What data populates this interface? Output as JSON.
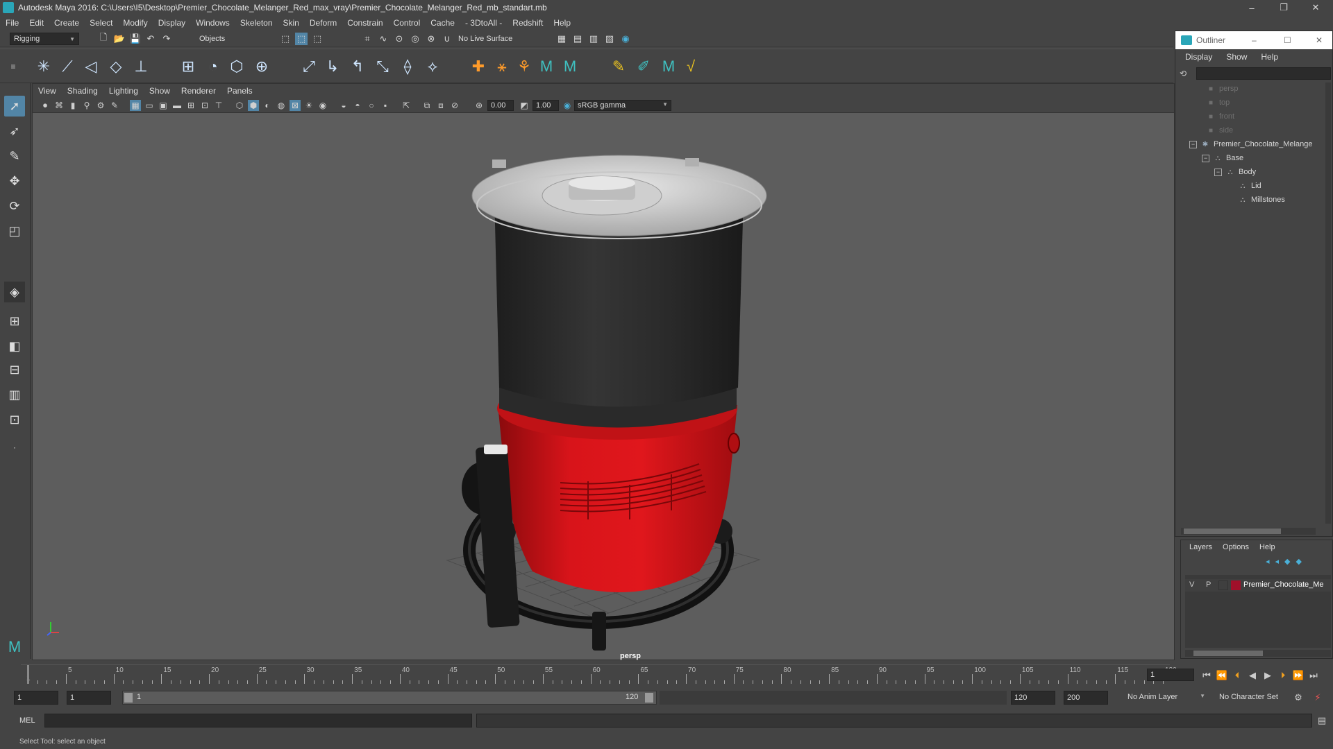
{
  "window": {
    "title": "Autodesk Maya 2016: C:\\Users\\I5\\Desktop\\Premier_Chocolate_Melanger_Red_max_vray\\Premier_Chocolate_Melanger_Red_mb_standart.mb",
    "minimize": "–",
    "maximize": "❐",
    "close": "✕"
  },
  "menubar": [
    "File",
    "Edit",
    "Create",
    "Select",
    "Modify",
    "Display",
    "Windows",
    "Skeleton",
    "Skin",
    "Deform",
    "Constrain",
    "Control",
    "Cache",
    "- 3DtoAll -",
    "Redshift",
    "Help"
  ],
  "statusline": {
    "menuset": "Rigging",
    "selection_mode": "Objects",
    "live_surface": "No Live Surface"
  },
  "viewport": {
    "menu": [
      "View",
      "Shading",
      "Lighting",
      "Show",
      "Renderer",
      "Panels"
    ],
    "exposure": "0.00",
    "gamma": "1.00",
    "color_space": "sRGB gamma",
    "camera_label": "persp"
  },
  "outliner": {
    "title": "Outliner",
    "menu": [
      "Display",
      "Show",
      "Help"
    ],
    "items": [
      {
        "label": "persp",
        "type": "camera"
      },
      {
        "label": "top",
        "type": "camera"
      },
      {
        "label": "front",
        "type": "camera"
      },
      {
        "label": "side",
        "type": "camera"
      },
      {
        "label": "Premier_Chocolate_Melange",
        "type": "group"
      },
      {
        "label": "Base",
        "type": "mesh"
      },
      {
        "label": "Body",
        "type": "mesh"
      },
      {
        "label": "Lid",
        "type": "mesh"
      },
      {
        "label": "Millstones",
        "type": "mesh"
      }
    ]
  },
  "layers": {
    "menu": [
      "Layers",
      "Options",
      "Help"
    ],
    "row": {
      "visible": "V",
      "playback": "P",
      "name": "Premier_Chocolate_Me",
      "color": "#a0102a"
    }
  },
  "timeline": {
    "ticks": [
      "5",
      "10",
      "15",
      "20",
      "25",
      "30",
      "35",
      "40",
      "45",
      "50",
      "55",
      "60",
      "65",
      "70",
      "75",
      "80",
      "85",
      "90",
      "95",
      "100",
      "105",
      "110",
      "115",
      "120"
    ],
    "first_tick": "1",
    "current_frame": "1"
  },
  "range": {
    "start": "1",
    "playback_start": "1",
    "slider_start": "1",
    "slider_end": "120",
    "playback_end": "120",
    "end": "200",
    "anim_layer": "No Anim Layer",
    "character_set": "No Character Set"
  },
  "command": {
    "language": "MEL"
  },
  "help_line": "Select Tool: select an object",
  "colors": {
    "body_red": "#d8141a",
    "accent": "#5285a6"
  }
}
